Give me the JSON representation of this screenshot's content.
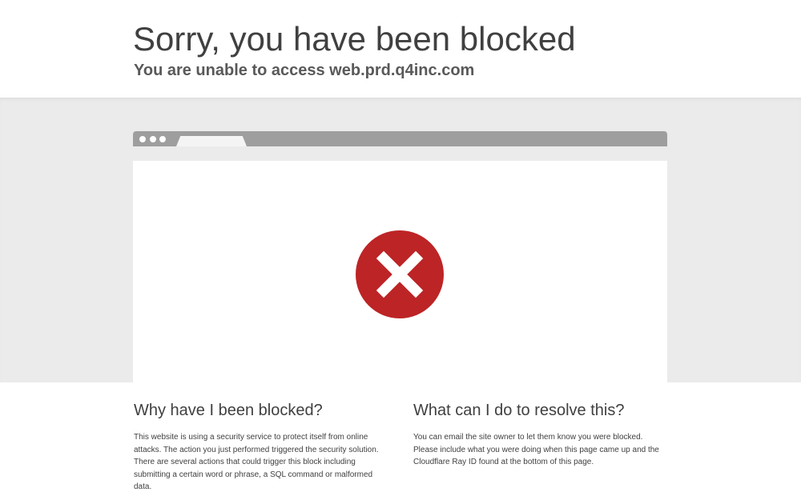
{
  "header": {
    "title": "Sorry, you have been blocked",
    "subtitle": "You are unable to access web.prd.q4inc.com"
  },
  "browser_illustration": {
    "icon": "blocked-x-icon",
    "icon_color": "#bd2426"
  },
  "why_section": {
    "heading": "Why have I been blocked?",
    "body": "This website is using a security service to protect itself from online attacks. The action you just performed triggered the security solution. There are several actions that could trigger this block including submitting a certain word or phrase, a SQL command or malformed data."
  },
  "resolve_section": {
    "heading": "What can I do to resolve this?",
    "body": "You can email the site owner to let them know you were blocked. Please include what you were doing when this page came up and the Cloudflare Ray ID found at the bottom of this page."
  }
}
